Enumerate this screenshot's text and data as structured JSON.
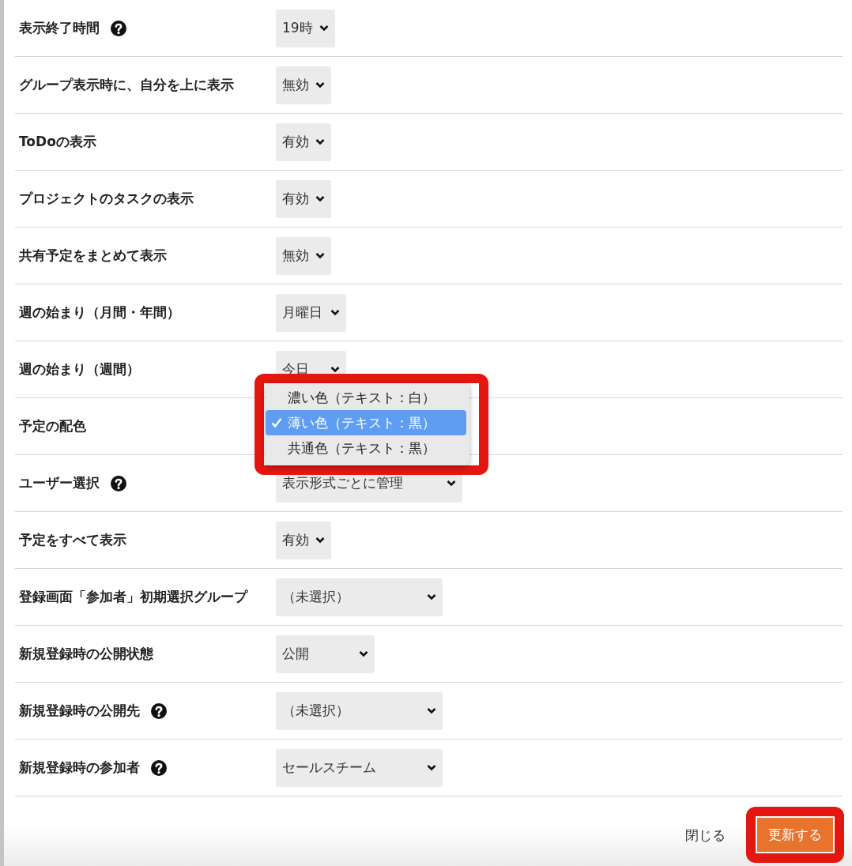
{
  "settings": [
    {
      "label": "表示終了時間",
      "help": true,
      "value": "19時"
    },
    {
      "label": "グループ表示時に、自分を上に表示",
      "help": false,
      "value": "無効"
    },
    {
      "label": "ToDoの表示",
      "help": false,
      "value": "有効"
    },
    {
      "label": "プロジェクトのタスクの表示",
      "help": false,
      "value": "有効"
    },
    {
      "label": "共有予定をまとめて表示",
      "help": false,
      "value": "無効"
    },
    {
      "label": "週の始まり（月間・年間）",
      "help": false,
      "value": "月曜日"
    },
    {
      "label": "週の始まり（週間）",
      "help": false,
      "value": "今日"
    },
    {
      "label": "予定の配色",
      "help": false,
      "menu": [
        {
          "label": "濃い色（テキスト：白）",
          "selected": false
        },
        {
          "label": "薄い色（テキスト：黒）",
          "selected": true
        },
        {
          "label": "共通色（テキスト：黒）",
          "selected": false
        }
      ]
    },
    {
      "label": "ユーザー選択",
      "help": true,
      "value": "表示形式ごとに管理"
    },
    {
      "label": "予定をすべて表示",
      "help": false,
      "value": "有効"
    },
    {
      "label": "登録画面「参加者」初期選択グループ",
      "help": false,
      "value": "（未選択）"
    },
    {
      "label": "新規登録時の公開状態",
      "help": false,
      "value": "公開"
    },
    {
      "label": "新規登録時の公開先",
      "help": true,
      "value": "（未選択）"
    },
    {
      "label": "新規登録時の参加者",
      "help": true,
      "value": "セールスチーム"
    }
  ],
  "footer": {
    "close": "閉じる",
    "submit": "更新する"
  }
}
